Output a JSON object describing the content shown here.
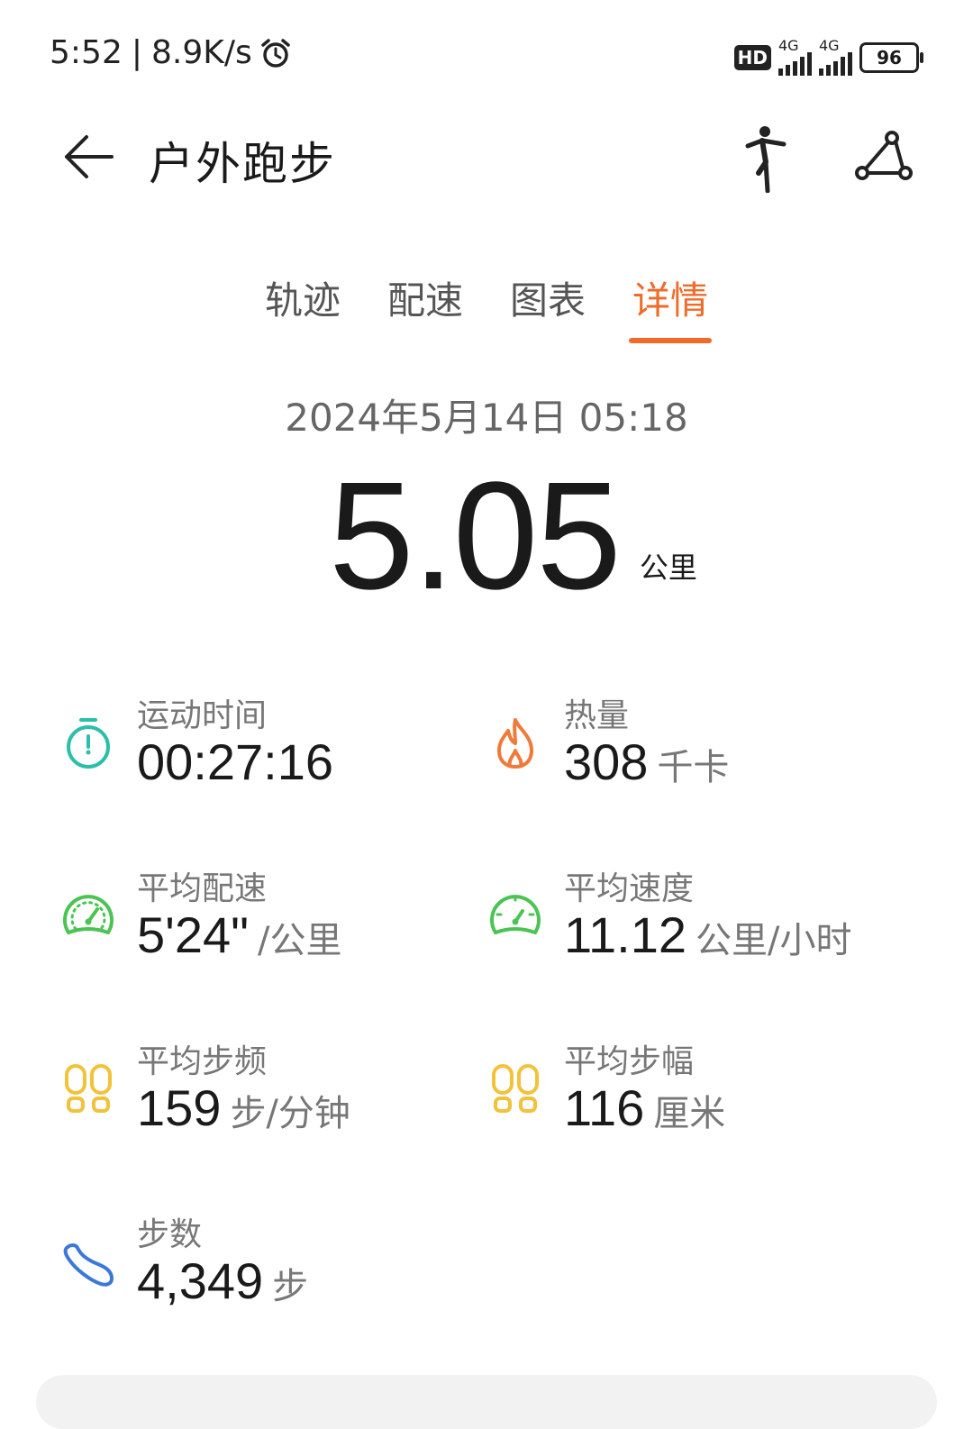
{
  "status_bar": {
    "time": "5:52",
    "separator": "|",
    "net_speed": "8.9K/s",
    "hd_badge": "HD",
    "signal1_label": "4G",
    "signal2_label": "4G",
    "battery": "96"
  },
  "header": {
    "title": "户外跑步"
  },
  "tabs": [
    {
      "label": "轨迹",
      "active": false
    },
    {
      "label": "配速",
      "active": false
    },
    {
      "label": "图表",
      "active": false
    },
    {
      "label": "详情",
      "active": true
    }
  ],
  "summary": {
    "datetime": "2024年5月14日 05:18",
    "distance": "5.05",
    "distance_unit": "公里"
  },
  "stats": {
    "duration": {
      "label": "运动时间",
      "value": "00:27:16",
      "unit": "",
      "icon": "stopwatch-icon",
      "color": "#2bbfa9"
    },
    "calories": {
      "label": "热量",
      "value": "308",
      "unit": "千卡",
      "icon": "flame-icon",
      "color": "#ef7a3a"
    },
    "avg_pace": {
      "label": "平均配速",
      "value": "5'24\"",
      "unit": "/公里",
      "icon": "speedometer-icon",
      "color": "#4bc454"
    },
    "avg_speed": {
      "label": "平均速度",
      "value": "11.12",
      "unit": "公里/小时",
      "icon": "gauge-icon",
      "color": "#4bc454"
    },
    "avg_cadence": {
      "label": "平均步频",
      "value": "159",
      "unit": "步/分钟",
      "icon": "footprints-icon",
      "color": "#f2c23a"
    },
    "avg_stride": {
      "label": "平均步幅",
      "value": "116",
      "unit": "厘米",
      "icon": "footprints-icon",
      "color": "#f2c23a"
    },
    "steps": {
      "label": "步数",
      "value": "4,349",
      "unit": "步",
      "icon": "shoe-icon",
      "color": "#3b78d8"
    }
  },
  "colors": {
    "accent": "#ef6b2a"
  }
}
